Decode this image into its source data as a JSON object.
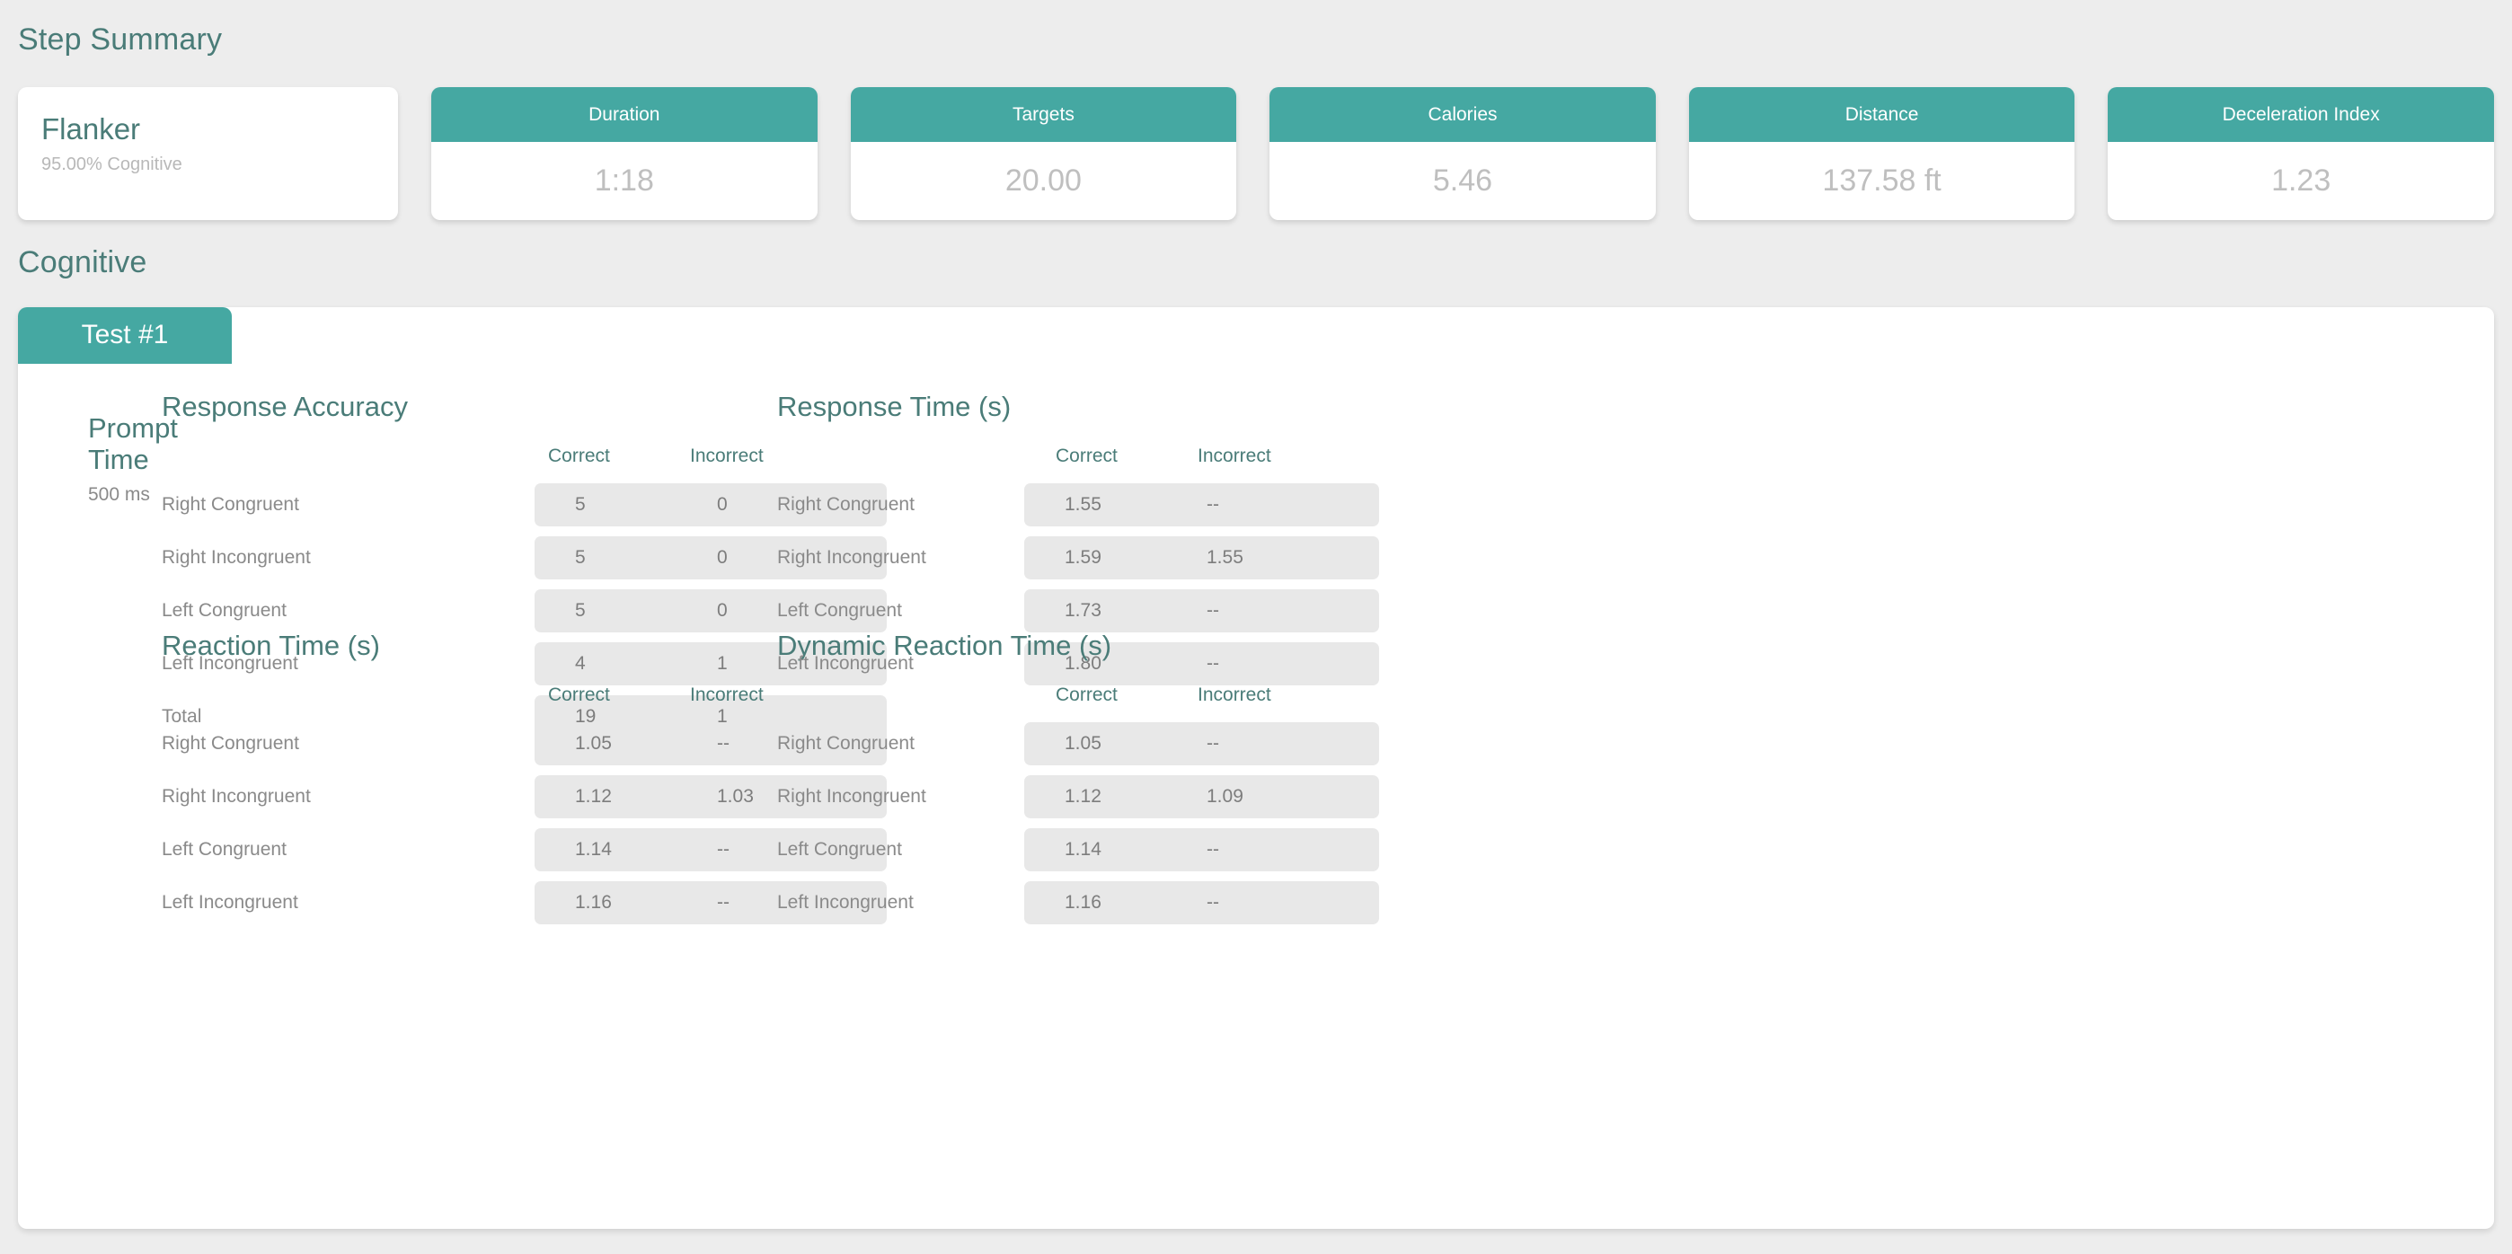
{
  "page": {
    "step_summary_heading": "Step Summary",
    "cognitive_heading": "Cognitive"
  },
  "summary": {
    "activity": {
      "name": "Flanker",
      "subtitle": "95.00% Cognitive"
    },
    "stats": [
      {
        "label": "Duration",
        "value": "1:18"
      },
      {
        "label": "Targets",
        "value": "20.00"
      },
      {
        "label": "Calories",
        "value": "5.46"
      },
      {
        "label": "Distance",
        "value": "137.58 ft"
      },
      {
        "label": "Deceleration Index",
        "value": "1.23"
      }
    ]
  },
  "cognitive": {
    "tabs": [
      {
        "label": "Test #1",
        "active": true
      }
    ],
    "prompt_time": {
      "label_line1": "Prompt",
      "label_line2": "Time",
      "value": "500 ms"
    },
    "columns": [
      "Correct",
      "Incorrect"
    ],
    "metrics": [
      {
        "title": "Response Accuracy",
        "rows": [
          {
            "label": "Right Congruent",
            "correct": "5",
            "incorrect": "0"
          },
          {
            "label": "Right Incongruent",
            "correct": "5",
            "incorrect": "0"
          },
          {
            "label": "Left Congruent",
            "correct": "5",
            "incorrect": "0"
          },
          {
            "label": "Left Incongruent",
            "correct": "4",
            "incorrect": "1"
          },
          {
            "label": "Total",
            "correct": "19",
            "incorrect": "1"
          }
        ]
      },
      {
        "title": "Response Time (s)",
        "rows": [
          {
            "label": "Right Congruent",
            "correct": "1.55",
            "incorrect": "--"
          },
          {
            "label": "Right Incongruent",
            "correct": "1.59",
            "incorrect": "1.55"
          },
          {
            "label": "Left Congruent",
            "correct": "1.73",
            "incorrect": "--"
          },
          {
            "label": "Left Incongruent",
            "correct": "1.80",
            "incorrect": "--"
          }
        ]
      },
      {
        "title": "Reaction Time (s)",
        "rows": [
          {
            "label": "Right Congruent",
            "correct": "1.05",
            "incorrect": "--"
          },
          {
            "label": "Right Incongruent",
            "correct": "1.12",
            "incorrect": "1.03"
          },
          {
            "label": "Left Congruent",
            "correct": "1.14",
            "incorrect": "--"
          },
          {
            "label": "Left Incongruent",
            "correct": "1.16",
            "incorrect": "--"
          }
        ]
      },
      {
        "title": "Dynamic Reaction Time (s)",
        "rows": [
          {
            "label": "Right Congruent",
            "correct": "1.05",
            "incorrect": "--"
          },
          {
            "label": "Right Incongruent",
            "correct": "1.12",
            "incorrect": "1.09"
          },
          {
            "label": "Left Congruent",
            "correct": "1.14",
            "incorrect": "--"
          },
          {
            "label": "Left Incongruent",
            "correct": "1.16",
            "incorrect": "--"
          }
        ]
      }
    ]
  },
  "colors": {
    "accent_teal": "#45A8A2",
    "heading_teal": "#4A7C78",
    "row_bg": "#E8E8E8",
    "page_bg": "#EDEDED",
    "muted_text": "#8A8A8A",
    "value_text": "#BFBFBF"
  }
}
